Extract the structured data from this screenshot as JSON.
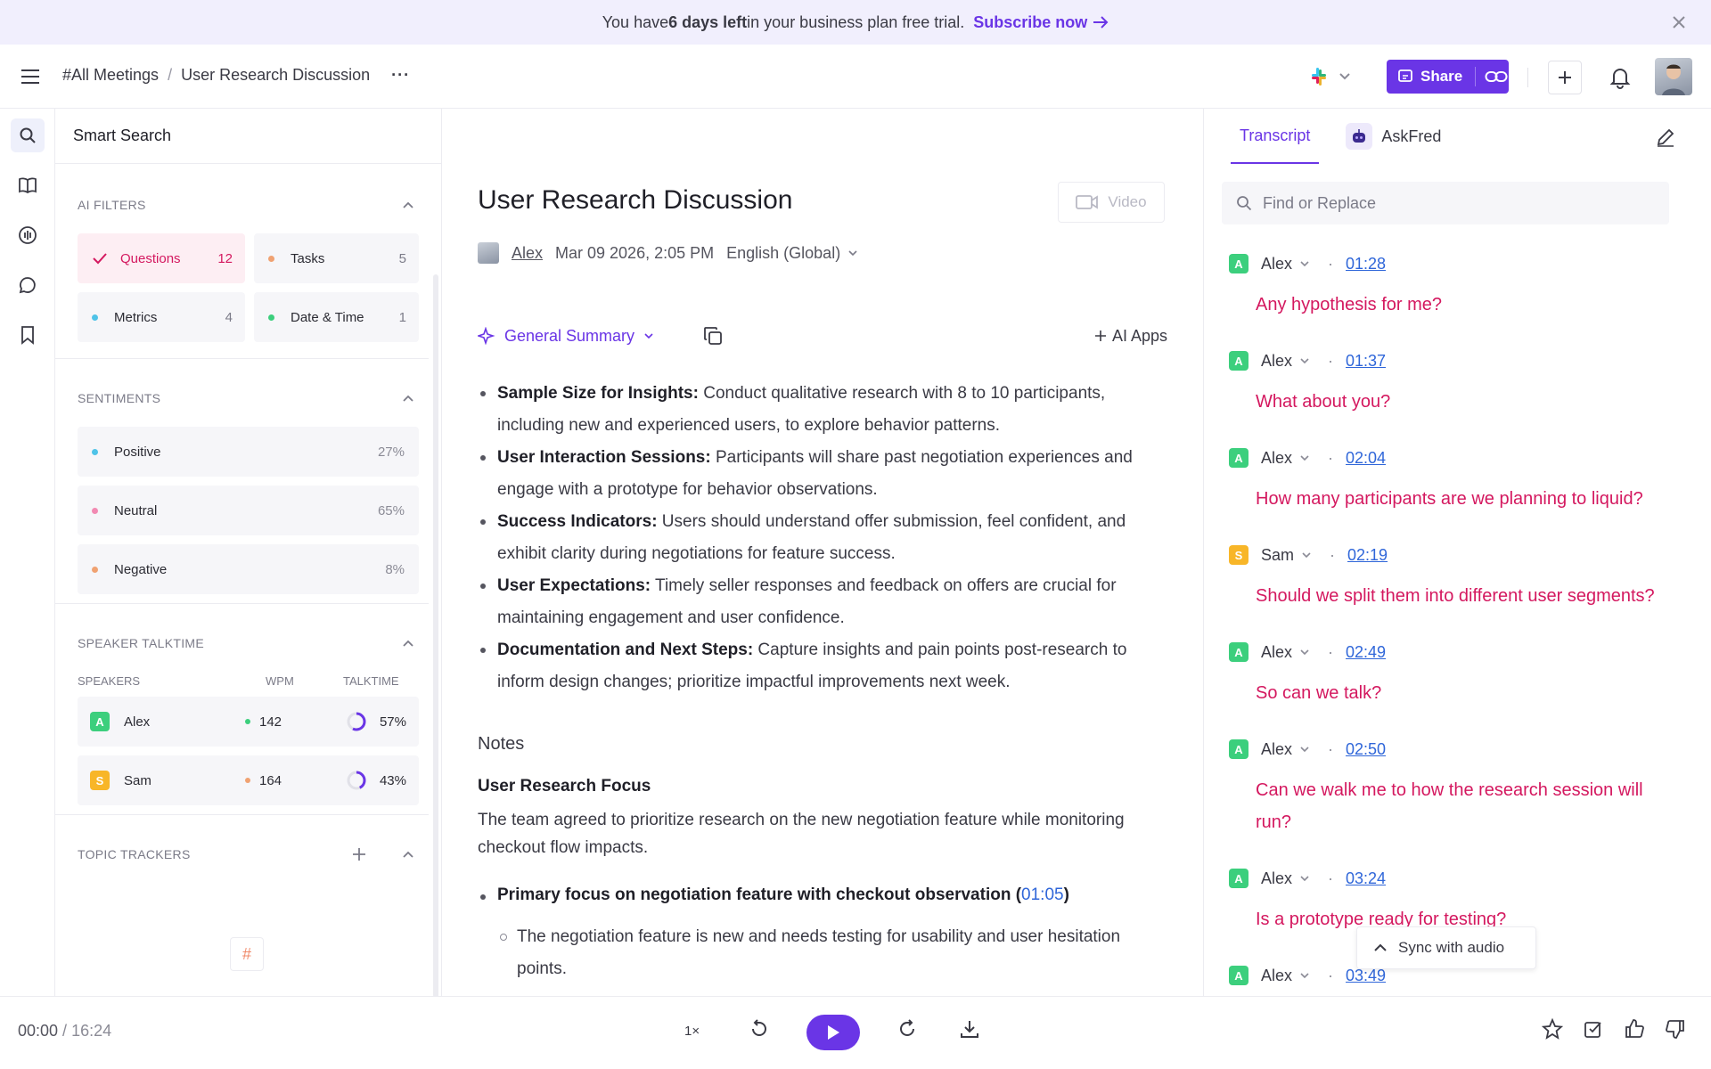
{
  "banner": {
    "prefix": "You have ",
    "days": "6 days left",
    "suffix": " in your business plan free trial.",
    "cta": "Subscribe now"
  },
  "header": {
    "breadcrumb_root": "#All Meetings",
    "breadcrumb_sep": "/",
    "breadcrumb_current": "User Research Discussion",
    "more": "···",
    "share_label": "Share"
  },
  "left": {
    "title": "Smart Search",
    "ai_filters_title": "AI FILTERS",
    "filters": [
      {
        "label": "Questions",
        "count": "12",
        "color": "#d4185f"
      },
      {
        "label": "Tasks",
        "count": "5",
        "color": "#f0a272"
      },
      {
        "label": "Metrics",
        "count": "4",
        "color": "#4fc3e8"
      },
      {
        "label": "Date & Time",
        "count": "1",
        "color": "#3ccf7d"
      }
    ],
    "sentiments_title": "SENTIMENTS",
    "sentiments": [
      {
        "label": "Positive",
        "pct": "27%",
        "color": "#4fc3e8"
      },
      {
        "label": "Neutral",
        "pct": "65%",
        "color": "#f28ab3"
      },
      {
        "label": "Negative",
        "pct": "8%",
        "color": "#f0a272"
      }
    ],
    "talktime_title": "SPEAKER TALKTIME",
    "col_speakers": "SPEAKERS",
    "col_wpm": "WPM",
    "col_talktime": "TALKTIME",
    "speakers": [
      {
        "initial": "A",
        "name": "Alex",
        "wpm": "142",
        "pct": "57%",
        "fraction": 0.57
      },
      {
        "initial": "S",
        "name": "Sam",
        "wpm": "164",
        "pct": "43%",
        "fraction": 0.43
      }
    ],
    "topic_title": "TOPIC TRACKERS",
    "hash": "#"
  },
  "main": {
    "title": "User Research Discussion",
    "video_label": "Video",
    "author": "Alex",
    "date": "Mar 09 2026, 2:05 PM",
    "language": "English (Global)",
    "summary_label": "General Summary",
    "ai_apps_label": "AI Apps",
    "bullets": [
      {
        "head": "Sample Size for Insights:",
        "text": " Conduct qualitative research with 8 to 10 participants, including new and experienced users, to explore behavior patterns."
      },
      {
        "head": "User Interaction Sessions:",
        "text": " Participants will share past negotiation experiences and engage with a prototype for behavior observations."
      },
      {
        "head": "Success Indicators:",
        "text": " Users should understand offer submission, feel confident, and exhibit clarity during negotiations for feature success."
      },
      {
        "head": "User Expectations:",
        "text": " Timely seller responses and feedback on offers are crucial for maintaining engagement and user confidence."
      },
      {
        "head": "Documentation and Next Steps:",
        "text": " Capture insights and pain points post-research to inform design changes; prioritize impactful improvements next week."
      }
    ],
    "notes_title": "Notes",
    "focus_title": "User Research Focus",
    "focus_text": "The team agreed to prioritize research on the new negotiation feature while monitoring checkout flow impacts.",
    "primary_text": "Primary focus on negotiation feature with checkout observation (",
    "primary_ts": "01:05",
    "primary_close": ")",
    "sub_text": "The negotiation feature is new and needs testing for usability and user hesitation points."
  },
  "right": {
    "tab_transcript": "Transcript",
    "tab_askfred": "AskFred",
    "search_placeholder": "Find or Replace",
    "entries": [
      {
        "initial": "A",
        "speaker": "Alex",
        "time": "01:28",
        "text": "Any hypothesis for me?"
      },
      {
        "initial": "A",
        "speaker": "Alex",
        "time": "01:37",
        "text": "What about you?"
      },
      {
        "initial": "A",
        "speaker": "Alex",
        "time": "02:04",
        "text": "How many participants are we planning to liquid?"
      },
      {
        "initial": "S",
        "speaker": "Sam",
        "time": "02:19",
        "text": "Should we split them into different user segments?"
      },
      {
        "initial": "A",
        "speaker": "Alex",
        "time": "02:49",
        "text": "So can we talk?"
      },
      {
        "initial": "A",
        "speaker": "Alex",
        "time": "02:50",
        "text": "Can we walk me to how the research session will run?"
      },
      {
        "initial": "A",
        "speaker": "Alex",
        "time": "03:24",
        "text": "Is a prototype ready for testing?"
      },
      {
        "initial": "A",
        "speaker": "Alex",
        "time": "03:49",
        "text": ""
      }
    ],
    "sync_label": "Sync with audio"
  },
  "player": {
    "current": "00:00",
    "sep": " / ",
    "total": "16:24",
    "speed": "1×"
  }
}
